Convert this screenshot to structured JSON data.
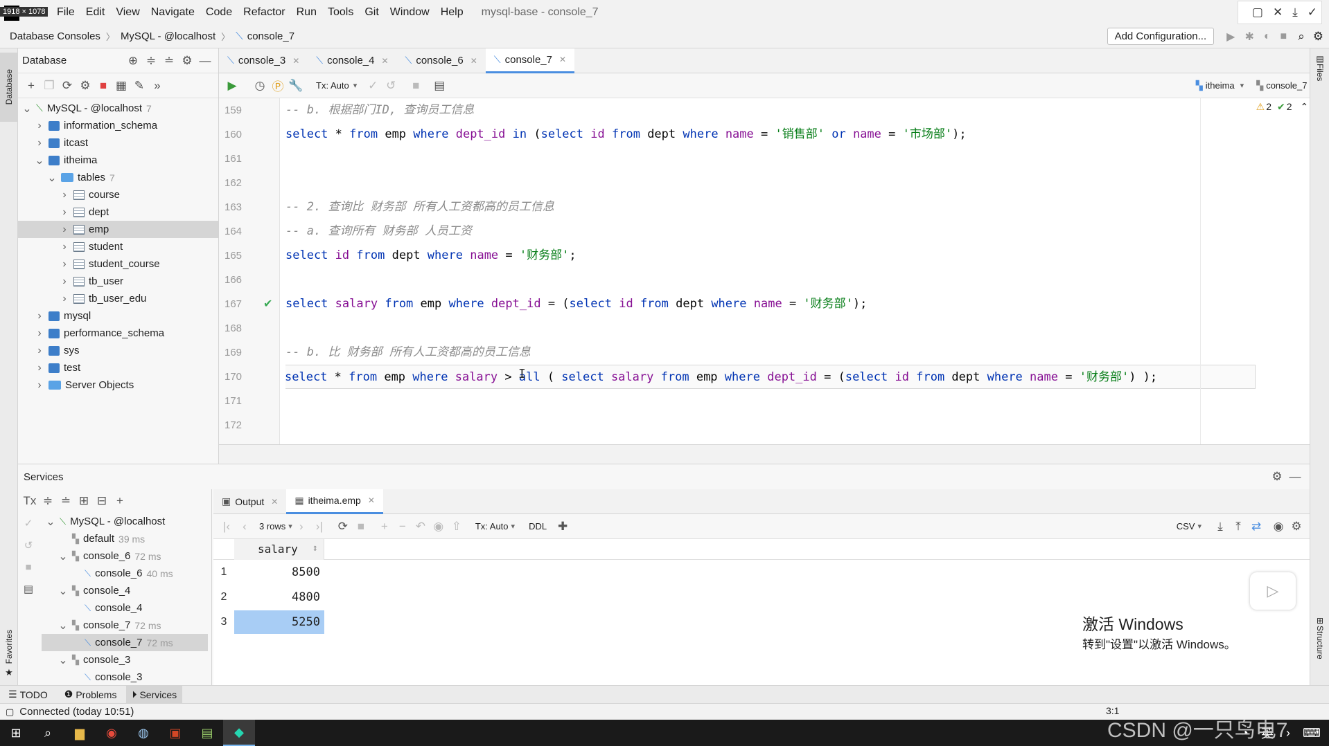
{
  "window": {
    "size_badge": "1918 × 1078",
    "title": "mysql-base - console_7"
  },
  "menu": [
    "File",
    "Edit",
    "View",
    "Navigate",
    "Code",
    "Refactor",
    "Run",
    "Tools",
    "Git",
    "Window",
    "Help"
  ],
  "breadcrumb": [
    "Database Consoles",
    "MySQL - @localhost",
    "console_7"
  ],
  "toolbar": {
    "add_config": "Add Configuration..."
  },
  "left_strip": {
    "database": "Database",
    "favorites": "Favorites"
  },
  "right_strip": {
    "files": "Files",
    "structure": "Structure"
  },
  "database_panel": {
    "title": "Database",
    "tree": [
      {
        "depth": 0,
        "arrow": "v",
        "icon": "mysql",
        "label": "MySQL - @localhost",
        "count": "7"
      },
      {
        "depth": 1,
        "arrow": ">",
        "icon": "db",
        "label": "information_schema",
        "count": ""
      },
      {
        "depth": 1,
        "arrow": ">",
        "icon": "db",
        "label": "itcast",
        "count": ""
      },
      {
        "depth": 1,
        "arrow": "v",
        "icon": "db",
        "label": "itheima",
        "count": ""
      },
      {
        "depth": 2,
        "arrow": "v",
        "icon": "folder",
        "label": "tables",
        "count": "7"
      },
      {
        "depth": 3,
        "arrow": ">",
        "icon": "table",
        "label": "course",
        "count": ""
      },
      {
        "depth": 3,
        "arrow": ">",
        "icon": "table",
        "label": "dept",
        "count": ""
      },
      {
        "depth": 3,
        "arrow": ">",
        "icon": "table",
        "label": "emp",
        "count": "",
        "selected": true
      },
      {
        "depth": 3,
        "arrow": ">",
        "icon": "table",
        "label": "student",
        "count": ""
      },
      {
        "depth": 3,
        "arrow": ">",
        "icon": "table",
        "label": "student_course",
        "count": ""
      },
      {
        "depth": 3,
        "arrow": ">",
        "icon": "table",
        "label": "tb_user",
        "count": ""
      },
      {
        "depth": 3,
        "arrow": ">",
        "icon": "table",
        "label": "tb_user_edu",
        "count": ""
      },
      {
        "depth": 1,
        "arrow": ">",
        "icon": "db",
        "label": "mysql",
        "count": ""
      },
      {
        "depth": 1,
        "arrow": ">",
        "icon": "db",
        "label": "performance_schema",
        "count": ""
      },
      {
        "depth": 1,
        "arrow": ">",
        "icon": "db",
        "label": "sys",
        "count": ""
      },
      {
        "depth": 1,
        "arrow": ">",
        "icon": "db",
        "label": "test",
        "count": ""
      },
      {
        "depth": 1,
        "arrow": ">",
        "icon": "server",
        "label": "Server Objects",
        "count": ""
      }
    ]
  },
  "editor": {
    "tabs": [
      {
        "label": "console_3",
        "active": false
      },
      {
        "label": "console_4",
        "active": false
      },
      {
        "label": "console_6",
        "active": false
      },
      {
        "label": "console_7",
        "active": true
      }
    ],
    "tx_mode": "Tx: Auto",
    "schema": "itheima",
    "session": "console_7",
    "warnings": "2",
    "oks": "2",
    "lines": [
      {
        "n": "159",
        "tokens": [
          [
            "cm",
            "-- b. 根据部门ID, 查询员工信息"
          ]
        ]
      },
      {
        "n": "160",
        "tokens": [
          [
            "kw",
            "select"
          ],
          [
            "pl",
            " * "
          ],
          [
            "kw",
            "from"
          ],
          [
            "pl",
            " emp "
          ],
          [
            "kw",
            "where"
          ],
          [
            "pl",
            " "
          ],
          [
            "fn",
            "dept_id"
          ],
          [
            "pl",
            " "
          ],
          [
            "kw",
            "in"
          ],
          [
            "pl",
            " ("
          ],
          [
            "kw",
            "select"
          ],
          [
            "pl",
            " "
          ],
          [
            "fn",
            "id"
          ],
          [
            "pl",
            " "
          ],
          [
            "kw",
            "from"
          ],
          [
            "pl",
            " dept "
          ],
          [
            "kw",
            "where"
          ],
          [
            "pl",
            " "
          ],
          [
            "fn",
            "name"
          ],
          [
            "pl",
            " = "
          ],
          [
            "st",
            "'销售部'"
          ],
          [
            "pl",
            " "
          ],
          [
            "kw",
            "or"
          ],
          [
            "pl",
            " "
          ],
          [
            "fn",
            "name"
          ],
          [
            "pl",
            " = "
          ],
          [
            "st",
            "'市场部'"
          ],
          [
            "pl",
            ");"
          ]
        ]
      },
      {
        "n": "161",
        "tokens": []
      },
      {
        "n": "162",
        "tokens": []
      },
      {
        "n": "163",
        "tokens": [
          [
            "cm",
            "-- 2. 查询比 财务部 所有人工资都高的员工信息"
          ]
        ]
      },
      {
        "n": "164",
        "tokens": [
          [
            "cm",
            "-- a. 查询所有 财务部 人员工资"
          ]
        ]
      },
      {
        "n": "165",
        "tokens": [
          [
            "kw",
            "select"
          ],
          [
            "pl",
            " "
          ],
          [
            "fn",
            "id"
          ],
          [
            "pl",
            " "
          ],
          [
            "kw",
            "from"
          ],
          [
            "pl",
            " dept "
          ],
          [
            "kw",
            "where"
          ],
          [
            "pl",
            " "
          ],
          [
            "fn",
            "name"
          ],
          [
            "pl",
            " = "
          ],
          [
            "st",
            "'财务部'"
          ],
          [
            "pl",
            ";"
          ]
        ]
      },
      {
        "n": "166",
        "tokens": []
      },
      {
        "n": "167",
        "check": true,
        "tokens": [
          [
            "kw",
            "select"
          ],
          [
            "pl",
            " "
          ],
          [
            "fn",
            "salary"
          ],
          [
            "pl",
            " "
          ],
          [
            "kw",
            "from"
          ],
          [
            "pl",
            " emp "
          ],
          [
            "kw",
            "where"
          ],
          [
            "pl",
            " "
          ],
          [
            "fn",
            "dept_id"
          ],
          [
            "pl",
            " = ("
          ],
          [
            "kw",
            "select"
          ],
          [
            "pl",
            " "
          ],
          [
            "fn",
            "id"
          ],
          [
            "pl",
            " "
          ],
          [
            "kw",
            "from"
          ],
          [
            "pl",
            " dept "
          ],
          [
            "kw",
            "where"
          ],
          [
            "pl",
            " "
          ],
          [
            "fn",
            "name"
          ],
          [
            "pl",
            " = "
          ],
          [
            "st",
            "'财务部'"
          ],
          [
            "pl",
            ");"
          ]
        ]
      },
      {
        "n": "168",
        "tokens": []
      },
      {
        "n": "169",
        "tokens": [
          [
            "cm",
            "-- b. 比 财务部 所有人工资都高的员工信息"
          ]
        ]
      },
      {
        "n": "170",
        "current": true,
        "tokens": [
          [
            "kw",
            "select"
          ],
          [
            "pl",
            " * "
          ],
          [
            "kw",
            "from"
          ],
          [
            "pl",
            " emp "
          ],
          [
            "kw",
            "where"
          ],
          [
            "pl",
            " "
          ],
          [
            "fn",
            "salary"
          ],
          [
            "pl",
            " > "
          ],
          [
            "kw",
            "all"
          ],
          [
            "pl",
            " ( "
          ],
          [
            "kw",
            "select"
          ],
          [
            "pl",
            " "
          ],
          [
            "fn",
            "salary"
          ],
          [
            "pl",
            " "
          ],
          [
            "kw",
            "from"
          ],
          [
            "pl",
            " emp "
          ],
          [
            "kw",
            "where"
          ],
          [
            "pl",
            " "
          ],
          [
            "fn",
            "dept_id"
          ],
          [
            "pl",
            " = ("
          ],
          [
            "kw",
            "select"
          ],
          [
            "pl",
            " "
          ],
          [
            "fn",
            "id"
          ],
          [
            "pl",
            " "
          ],
          [
            "kw",
            "from"
          ],
          [
            "pl",
            " dept "
          ],
          [
            "kw",
            "where"
          ],
          [
            "pl",
            " "
          ],
          [
            "fn",
            "name"
          ],
          [
            "pl",
            " = "
          ],
          [
            "st",
            "'财务部'"
          ],
          [
            "pl",
            ") );"
          ]
        ]
      },
      {
        "n": "171",
        "tokens": []
      },
      {
        "n": "172",
        "tokens": []
      }
    ]
  },
  "services": {
    "title": "Services",
    "tree": [
      {
        "depth": 0,
        "arrow": "v",
        "label": "MySQL - @localhost",
        "ms": ""
      },
      {
        "depth": 1,
        "arrow": "",
        "label": "default",
        "ms": "39 ms"
      },
      {
        "depth": 1,
        "arrow": "v",
        "label": "console_6",
        "ms": "72 ms"
      },
      {
        "depth": 2,
        "arrow": "",
        "label": "console_6",
        "ms": "40 ms"
      },
      {
        "depth": 1,
        "arrow": "v",
        "label": "console_4",
        "ms": ""
      },
      {
        "depth": 2,
        "arrow": "",
        "label": "console_4",
        "ms": ""
      },
      {
        "depth": 1,
        "arrow": "v",
        "label": "console_7",
        "ms": "72 ms"
      },
      {
        "depth": 2,
        "arrow": "",
        "label": "console_7",
        "ms": "72 ms",
        "selected": true
      },
      {
        "depth": 1,
        "arrow": "v",
        "label": "console_3",
        "ms": ""
      },
      {
        "depth": 2,
        "arrow": "",
        "label": "console_3",
        "ms": ""
      }
    ],
    "result_tabs": [
      {
        "label": "Output",
        "active": false
      },
      {
        "label": "itheima.emp",
        "active": true
      }
    ],
    "rows_label": "3 rows",
    "tx_mode": "Tx: Auto",
    "ddl": "DDL",
    "csv": "CSV",
    "column": "salary",
    "rows": [
      {
        "n": "1",
        "value": "8500"
      },
      {
        "n": "2",
        "value": "4800"
      },
      {
        "n": "3",
        "value": "5250",
        "selected": true
      }
    ]
  },
  "tool_windows": [
    "TODO",
    "Problems",
    "Services"
  ],
  "status": {
    "text": "Connected (today 10:51)",
    "pos": "3:1"
  },
  "watermark": {
    "activate_title": "激活 Windows",
    "activate_sub": "转到\"设置\"以激活 Windows。",
    "csdn": "CSDN @一只鸟电7"
  },
  "colors": {
    "accent": "#4a8ee0",
    "keyword": "#0033b3",
    "string": "#067d17",
    "field": "#871094",
    "comment": "#8c8c8c",
    "selection": "#a8cdf5"
  }
}
